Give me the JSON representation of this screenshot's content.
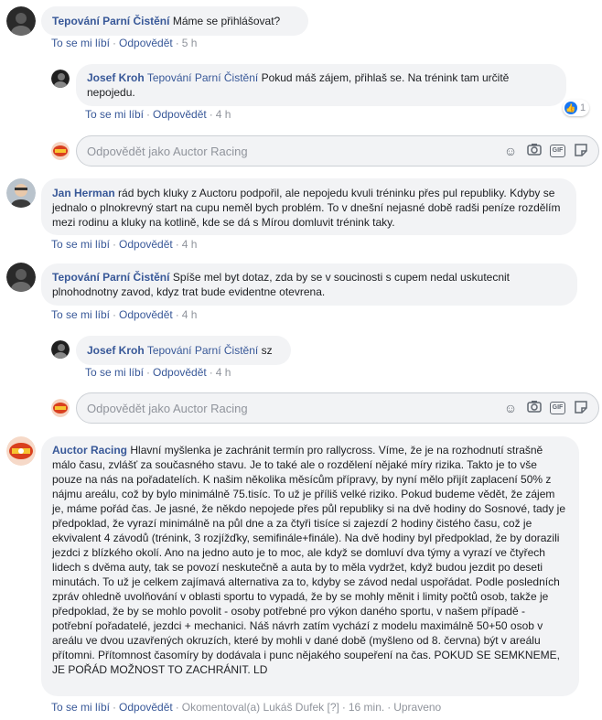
{
  "comments": [
    {
      "author": "Tepování Parní Čistění",
      "text": "Máme se přihlášovat?",
      "actions": {
        "like": "To se mi líbí",
        "reply": "Odpovědět",
        "time": "5 h"
      },
      "replies": [
        {
          "author": "Josef Kroh",
          "tag": "Tepování Parní Čistění",
          "text": "Pokud máš zájem, přihlaš se. Na trénink tam určitě nepojedu.",
          "actions": {
            "like": "To se mi líbí",
            "reply": "Odpovědět",
            "time": "4 h"
          },
          "reaction_count": "1"
        }
      ],
      "reply_placeholder": "Odpovědět jako Auctor Racing"
    },
    {
      "author": "Jan Herman",
      "text": "rád bych kluky z Auctoru podpořil, ale nepojedu kvuli tréninku přes pul republiky. Kdyby se jednalo o plnokrevný start na cupu neměl bych problém. To v dnešní nejasné době radši peníze rozdělím mezi rodinu a kluky na kotlině, kde se dá s Mírou domluvit trénink taky.",
      "actions": {
        "like": "To se mi líbí",
        "reply": "Odpovědět",
        "time": "4 h"
      }
    },
    {
      "author": "Tepování Parní Čistění",
      "text": "Spíše mel byt dotaz, zda by se v soucinosti s cupem nedal uskutecnit plnohodnotny zavod, kdyz trat bude evidentne otevrena.",
      "actions": {
        "like": "To se mi líbí",
        "reply": "Odpovědět",
        "time": "4 h"
      },
      "replies": [
        {
          "author": "Josef Kroh",
          "tag": "Tepování Parní Čistění",
          "text": "sz",
          "actions": {
            "like": "To se mi líbí",
            "reply": "Odpovědět",
            "time": "4 h"
          }
        }
      ],
      "reply_placeholder": "Odpovědět jako Auctor Racing"
    },
    {
      "author": "Auctor Racing",
      "text": "Hlavní myšlenka je zachránit termín pro rallycross. Víme, že je na rozhodnutí strašně málo času, zvlášť za současného stavu. Je to také ale o rozdělení nějaké míry rizika. Takto je to vše pouze na nás na pořadatelích. K našim několika měsícům přípravy, by nyní mělo přijít zaplacení 50% z nájmu areálu, což by bylo minimálně 75.tisíc. To už je příliš velké riziko. Pokud budeme vědět, že zájem je, máme pořád čas. Je jasné, že někdo nepojede přes půl republiky si na dvě hodiny do Sosnové, tady je předpoklad, že vyrazí minimálně na půl dne a za čtyři tisíce si zajezdí 2 hodiny čistého času, což je ekvivalent 4 závodů (trénink, 3 rozjížďky, semifinále+finále). Na dvě hodiny byl předpoklad, že by dorazili jezdci z blízkého okolí. Ano na jedno auto je to moc, ale když se domluví dva týmy a vyrazí ve čtyřech lidech s dvěma auty, tak se povozí neskutečně a auta by to měla vydržet, když budou jezdit po deseti minutách. To už je celkem zajímavá alternativa za to, kdyby se závod nedal uspořádat. Podle posledních zpráv ohledně uvolňování v oblasti sportu to vypadá, že by se mohly měnit i limity počtů osob, takže je předpoklad, že by se mohlo povolit - osoby potřebné pro výkon daného sportu, v našem případě - potřební pořadatelé, jezdci + mechanici. Náš návrh zatím vychází z modelu maximálně 50+50 osob v areálu ve dvou uzavřených okruzích, které by mohli v dané době (myšleno od 8. června) být v areálu přítomni. Přítomnost časomíry by dodávala i punc nějakého soupeření na čas. POKUD SE SEMKNEME, JE POŘÁD MOŽNOST TO ZACHRÁNIT. LD",
      "actions": {
        "like": "To se mi líbí",
        "reply": "Odpovědět",
        "commented_by": "Okomentoval(a) Lukáš Dufek",
        "bracket": "[?]",
        "time": "16 min.",
        "edited": "Upraveno"
      }
    }
  ],
  "icons": {
    "emoji": "emoji-icon",
    "camera": "camera-icon",
    "gif": "gif-icon",
    "sticker": "sticker-icon",
    "like": "like-reaction-icon"
  },
  "colors": {
    "link": "#385898",
    "bubble": "#f2f3f5",
    "meta": "#90949c",
    "like_blue": "#1877f2"
  }
}
